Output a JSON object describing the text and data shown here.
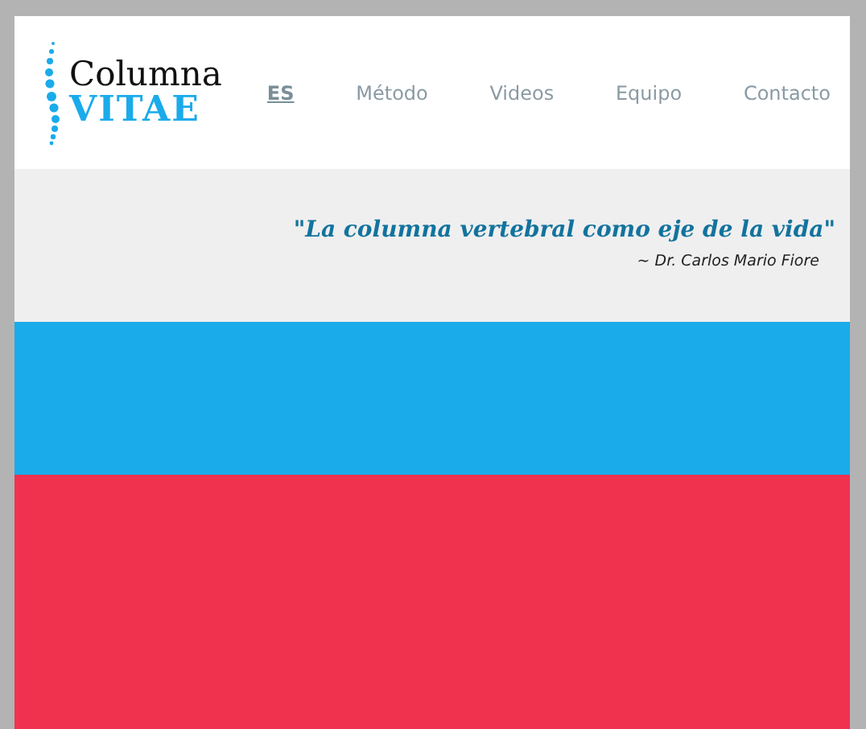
{
  "logo": {
    "line_1": "Columna",
    "line_2": "VITAE"
  },
  "nav": [
    {
      "label": "ES",
      "selected": true
    },
    {
      "label": "Método",
      "selected": false
    },
    {
      "label": "Videos",
      "selected": false
    },
    {
      "label": "Equipo",
      "selected": false
    },
    {
      "label": "Contacto",
      "selected": false
    }
  ],
  "quote": {
    "text": "\"La columna vertebral como eje de la vida\"",
    "author": "~ Dr. Carlos Mario Fiore"
  },
  "bands": [
    {
      "color": "#1aabeb"
    },
    {
      "color": "#f0324f"
    }
  ]
}
